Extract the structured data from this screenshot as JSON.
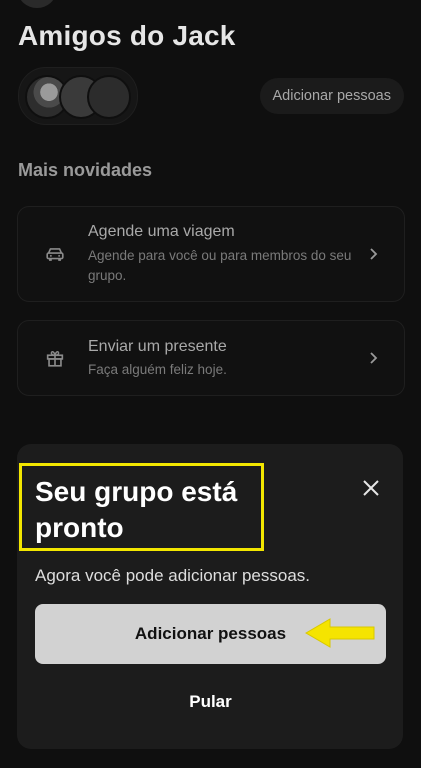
{
  "header": {
    "group_title": "Amigos do Jack",
    "add_people_label": "Adicionar pessoas"
  },
  "section": {
    "title": "Mais novidades"
  },
  "cards": [
    {
      "icon": "car-icon",
      "title": "Agende uma viagem",
      "subtitle": "Agende para você ou para membros do seu grupo."
    },
    {
      "icon": "gift-icon",
      "title": "Enviar um presente",
      "subtitle": "Faça alguém feliz hoje."
    }
  ],
  "sheet": {
    "title": "Seu grupo está pronto",
    "subtitle": "Agora você pode adicionar pessoas.",
    "primary_label": "Adicionar pessoas",
    "skip_label": "Pular"
  },
  "colors": {
    "highlight": "#f2e600",
    "arrow": "#f5e400",
    "background": "#0f0f0f",
    "sheet": "#1c1c1c"
  }
}
